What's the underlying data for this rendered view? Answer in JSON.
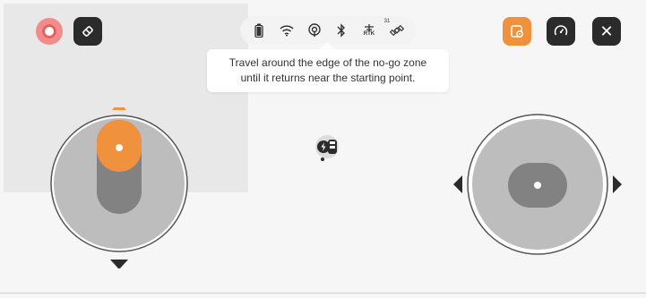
{
  "toolbar_left": {
    "record_icon": "record-icon",
    "eraser_icon": "eraser-icon"
  },
  "toolbar_right": {
    "map_icon": "map-settings-icon",
    "speed_icon": "speedometer-icon",
    "close_label": "✕"
  },
  "status_bar": {
    "battery_icon": "battery-icon",
    "wifi_icon": "wifi-icon",
    "cellular_icon": "signal-icon",
    "bluetooth_icon": "bluetooth-icon",
    "rtk_label": "RTK",
    "satellite_count": "31"
  },
  "tooltip": {
    "line1": "Travel around the edge of the no-go zone",
    "line2": "until it returns near the starting point."
  },
  "colors": {
    "accent": "#f0913d",
    "dark_button": "#2b2b2b",
    "record": "#e85d5d"
  }
}
